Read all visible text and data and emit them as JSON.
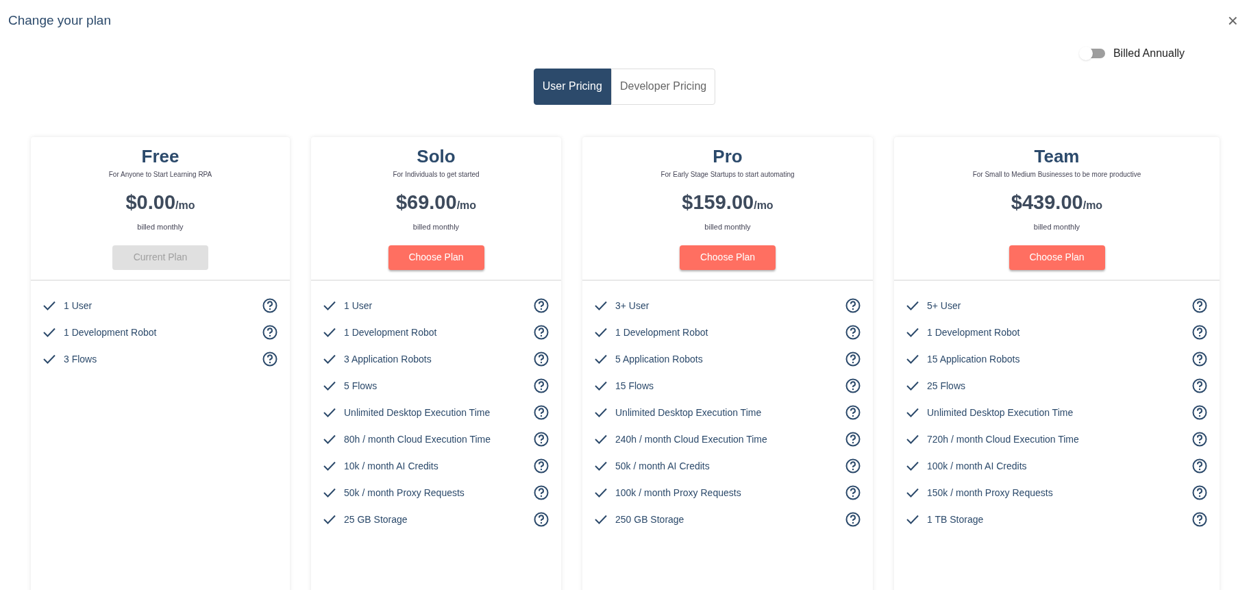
{
  "dialog": {
    "title": "Change your plan",
    "close": "×"
  },
  "billing_toggle": {
    "label": "Billed Annually",
    "on": false
  },
  "tabs": [
    {
      "label": "User Pricing",
      "selected": true
    },
    {
      "label": "Developer Pricing",
      "selected": false
    }
  ],
  "plans": [
    {
      "name": "Free",
      "tagline": "For Anyone to Start Learning RPA",
      "price": "$0.00",
      "period": "/mo",
      "billing": "billed monthly",
      "button": {
        "label": "Current Plan",
        "disabled": true
      },
      "features": [
        "1 User",
        "1 Development Robot",
        "3 Flows"
      ]
    },
    {
      "name": "Solo",
      "tagline": "For Individuals to get started",
      "price": "$69.00",
      "period": "/mo",
      "billing": "billed monthly",
      "button": {
        "label": "Choose Plan",
        "disabled": false
      },
      "features": [
        "1 User",
        "1 Development Robot",
        "3 Application Robots",
        "5 Flows",
        "Unlimited Desktop Execution Time",
        "80h / month Cloud Execution Time",
        "10k / month AI Credits",
        "50k / month Proxy Requests",
        "25 GB Storage"
      ]
    },
    {
      "name": "Pro",
      "tagline": "For Early Stage Startups to start automating",
      "price": "$159.00",
      "period": "/mo",
      "billing": "billed monthly",
      "button": {
        "label": "Choose Plan",
        "disabled": false
      },
      "features": [
        "3+ User",
        "1 Development Robot",
        "5 Application Robots",
        "15 Flows",
        "Unlimited Desktop Execution Time",
        "240h / month Cloud Execution Time",
        "50k / month AI Credits",
        "100k / month Proxy Requests",
        "250 GB Storage"
      ]
    },
    {
      "name": "Team",
      "tagline": "For Small to Medium Businesses to be more productive",
      "price": "$439.00",
      "period": "/mo",
      "billing": "billed monthly",
      "button": {
        "label": "Choose Plan",
        "disabled": false
      },
      "features": [
        "5+ User",
        "1 Development Robot",
        "15 Application Robots",
        "25 Flows",
        "Unlimited Desktop Execution Time",
        "720h / month Cloud Execution Time",
        "100k / month AI Credits",
        "150k / month Proxy Requests",
        "1 TB Storage"
      ]
    }
  ]
}
